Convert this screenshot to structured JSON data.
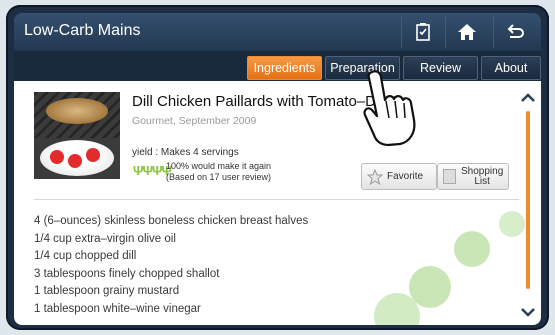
{
  "header": {
    "title": "Low-Carb Mains"
  },
  "toolbar": {
    "buttons": [
      {
        "icon": "checklist-icon"
      },
      {
        "icon": "home-icon"
      },
      {
        "icon": "back-icon"
      }
    ]
  },
  "tabs": [
    {
      "label": "Ingredients",
      "active": true
    },
    {
      "label": "Preparation",
      "active": false
    },
    {
      "label": "Review",
      "active": false
    },
    {
      "label": "About",
      "active": false
    }
  ],
  "recipe": {
    "title": "Dill Chicken Paillards with Tomato–Dill C",
    "source": "Gourmet, September 2009",
    "yield": "yield : Makes 4 servings",
    "rating_line1": "100% would make it again",
    "rating_line2": "(Based on 17 user review)",
    "favorite_label": "Favorite",
    "shopping_label_1": "Shopping",
    "shopping_label_2": "List"
  },
  "ingredients": [
    "4 (6–ounces) skinless boneless chicken breast halves",
    "1/4 cup extra–virgin olive oil",
    "1/4 cup chopped dill",
    "3 tablespoons finely chopped shallot",
    "1 tablespoon grainy mustard",
    "1 tablespoon white–wine vinegar"
  ],
  "colors": {
    "accent": "#f08a2f",
    "header": "#223851",
    "rating_green": "#8cc63f"
  }
}
